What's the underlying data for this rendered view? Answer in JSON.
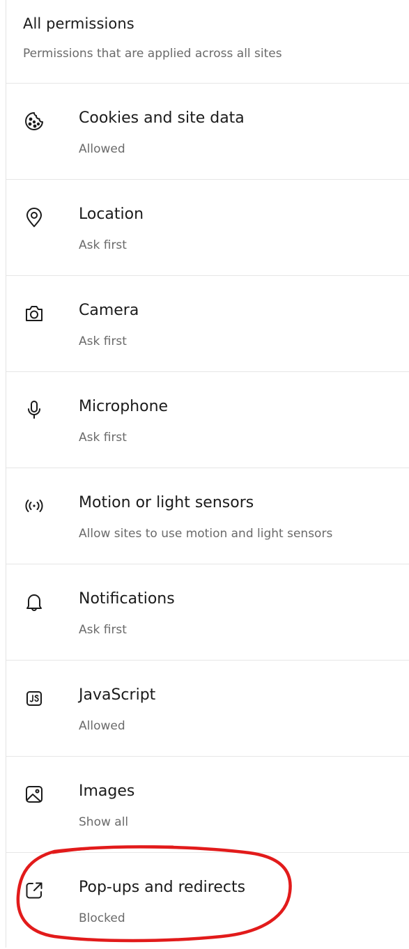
{
  "header": {
    "title": "All permissions",
    "subtitle": "Permissions that are applied across all sites"
  },
  "permissions": [
    {
      "icon": "cookie-icon",
      "label": "Cookies and site data",
      "status": "Allowed"
    },
    {
      "icon": "location-icon",
      "label": "Location",
      "status": "Ask first"
    },
    {
      "icon": "camera-icon",
      "label": "Camera",
      "status": "Ask first"
    },
    {
      "icon": "microphone-icon",
      "label": "Microphone",
      "status": "Ask first"
    },
    {
      "icon": "sensor-icon",
      "label": "Motion or light sensors",
      "status": "Allow sites to use motion and light sensors"
    },
    {
      "icon": "bell-icon",
      "label": "Notifications",
      "status": "Ask first"
    },
    {
      "icon": "javascript-icon",
      "label": "JavaScript",
      "status": "Allowed"
    },
    {
      "icon": "image-icon",
      "label": "Images",
      "status": "Show all"
    },
    {
      "icon": "open-external-icon",
      "label": "Pop-ups and redirects",
      "status": "Blocked"
    }
  ],
  "annotation": {
    "shape": "hand-drawn ellipse",
    "color": "#e21b1b",
    "target": "Pop-ups and redirects"
  }
}
